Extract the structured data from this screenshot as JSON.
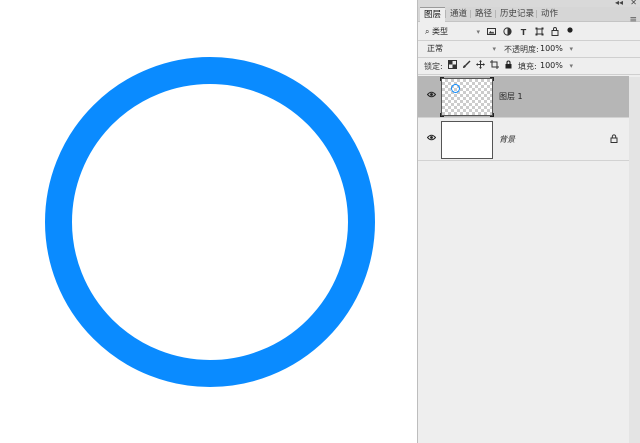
{
  "panel": {
    "tabs": [
      {
        "label": "图层",
        "active": true
      },
      {
        "label": "通道",
        "active": false
      },
      {
        "label": "路径",
        "active": false
      },
      {
        "label": "历史记录",
        "active": false
      },
      {
        "label": "动作",
        "active": false
      }
    ],
    "collapse_glyph": "◂◂",
    "close_glyph": "✕",
    "menu_glyph": "≡"
  },
  "filter": {
    "search_glyph": "⌕",
    "kind_label": "类型",
    "icons": [
      "image-filter-icon",
      "adjustment-filter-icon",
      "type-filter-icon",
      "shape-filter-icon",
      "smart-object-filter-icon",
      "filter-toggle-icon"
    ]
  },
  "blend": {
    "mode": "正常",
    "opacity_label": "不透明度:",
    "opacity_value": "100%"
  },
  "lock": {
    "label": "锁定:",
    "fill_label": "填充:",
    "fill_value": "100%"
  },
  "layers": [
    {
      "name": "图层 1",
      "selected": true,
      "visible": true,
      "transparent": true,
      "locked": false
    },
    {
      "name": "背景",
      "selected": false,
      "visible": true,
      "transparent": false,
      "locked": true
    }
  ],
  "colors": {
    "ring": "#0a8bff",
    "panel_bg": "#eeeeee",
    "selected_layer": "#b6b6b6"
  }
}
